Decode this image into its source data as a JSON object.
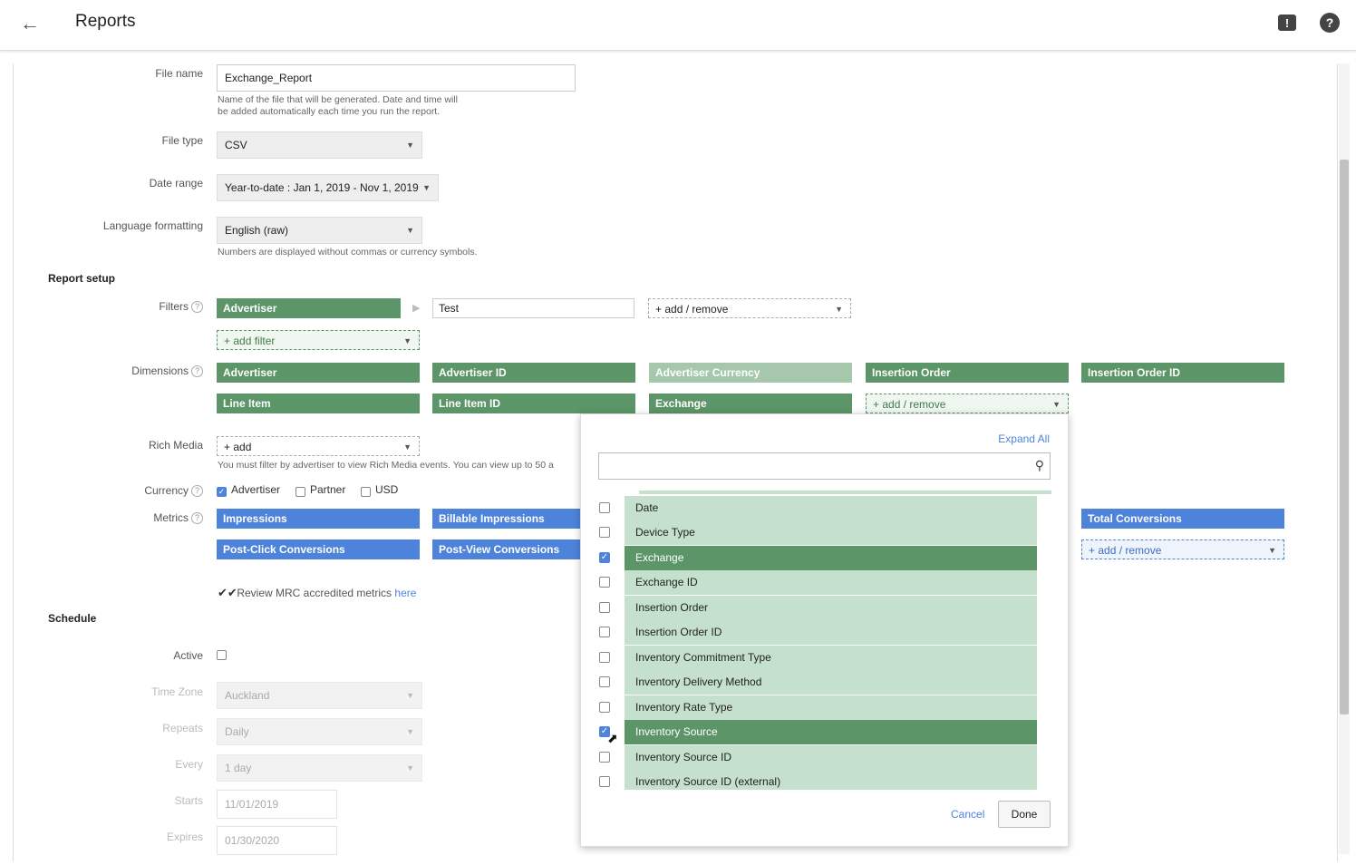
{
  "header": {
    "back_icon": "arrow-left-icon",
    "title": "Reports",
    "feedback_icon": "feedback-icon",
    "help_icon": "help-icon"
  },
  "file": {
    "name_label": "File name",
    "name_value": "Exchange_Report",
    "name_hint_1": "Name of the file that will be generated. Date and time will",
    "name_hint_2": "be added automatically each time you run the report.",
    "type_label": "File type",
    "type_value": "CSV",
    "date_label": "Date range",
    "date_value": "Year-to-date : Jan 1, 2019 - Nov 1, 2019",
    "lang_label": "Language formatting",
    "lang_value": "English (raw)",
    "lang_hint": "Numbers are displayed without commas or currency symbols."
  },
  "report_setup": {
    "title": "Report setup",
    "filters_label": "Filters",
    "filter_chip": "Advertiser",
    "filter_value": "Test",
    "filter_add_remove": "+ add / remove",
    "add_filter": "+ add filter",
    "dimensions_label": "Dimensions",
    "dimensions": [
      "Advertiser",
      "Advertiser ID",
      "Advertiser Currency",
      "Insertion Order",
      "Insertion Order ID",
      "Line Item",
      "Line Item ID",
      "Exchange"
    ],
    "dimensions_add_remove": "+ add / remove",
    "rich_media_label": "Rich Media",
    "rich_media_add": "+ add",
    "rich_media_hint": "You must filter by advertiser to view Rich Media events. You can view up to 50 a",
    "currency_label": "Currency",
    "currency_options": [
      "Advertiser",
      "Partner",
      "USD"
    ],
    "metrics_label": "Metrics",
    "metrics": [
      "Impressions",
      "Billable Impressions",
      "Total Conversions",
      "Post-Click Conversions",
      "Post-View Conversions"
    ],
    "metrics_add_remove": "+ add / remove",
    "mrc_text": "Review MRC accredited metrics ",
    "mrc_link": "here"
  },
  "schedule": {
    "title": "Schedule",
    "active_label": "Active",
    "timezone_label": "Time Zone",
    "timezone_value": "Auckland",
    "repeats_label": "Repeats",
    "repeats_value": "Daily",
    "every_label": "Every",
    "every_value": "1 day",
    "starts_label": "Starts",
    "starts_value": "11/01/2019",
    "expires_label": "Expires",
    "expires_value": "01/30/2020"
  },
  "popup": {
    "expand_all": "Expand All",
    "search_placeholder": "",
    "items": [
      {
        "label": "Date",
        "checked": false
      },
      {
        "label": "Device Type",
        "checked": false
      },
      {
        "label": "Exchange",
        "checked": true
      },
      {
        "label": "Exchange ID",
        "checked": false
      },
      {
        "label": "Insertion Order",
        "checked": false
      },
      {
        "label": "Insertion Order ID",
        "checked": false
      },
      {
        "label": "Inventory Commitment Type",
        "checked": false
      },
      {
        "label": "Inventory Delivery Method",
        "checked": false
      },
      {
        "label": "Inventory Rate Type",
        "checked": false
      },
      {
        "label": "Inventory Source",
        "checked": true
      },
      {
        "label": "Inventory Source ID",
        "checked": false
      },
      {
        "label": "Inventory Source ID (external)",
        "checked": false
      }
    ],
    "cancel": "Cancel",
    "done": "Done"
  }
}
